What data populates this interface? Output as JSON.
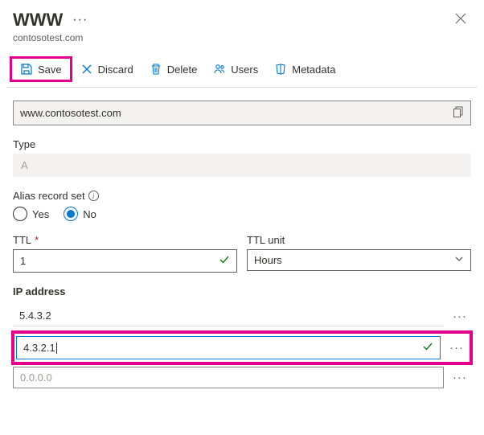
{
  "header": {
    "title": "WWW",
    "subtitle": "contosotest.com"
  },
  "toolbar": {
    "save_label": "Save",
    "discard_label": "Discard",
    "delete_label": "Delete",
    "users_label": "Users",
    "metadata_label": "Metadata"
  },
  "fqdn": {
    "value": "www.contosotest.com"
  },
  "type": {
    "label": "Type",
    "value": "A"
  },
  "alias": {
    "label": "Alias record set",
    "yes_label": "Yes",
    "no_label": "No",
    "selected": "No"
  },
  "ttl": {
    "label": "TTL",
    "value": "1"
  },
  "ttl_unit": {
    "label": "TTL unit",
    "value": "Hours"
  },
  "ip": {
    "header": "IP address",
    "rows": [
      {
        "value": "5.4.3.2"
      },
      {
        "value": "4.3.2.1"
      },
      {
        "value": "0.0.0.0"
      }
    ]
  },
  "colors": {
    "highlight": "#e3008c",
    "accent": "#0078d4",
    "success": "#107c10"
  }
}
